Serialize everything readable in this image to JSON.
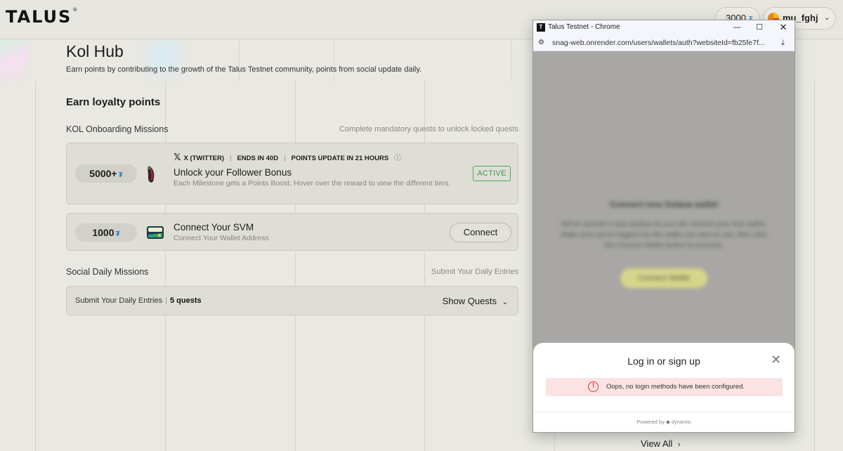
{
  "brand": {
    "logo_text": "TALUS",
    "logo_mark": "®"
  },
  "header": {
    "points": "3000",
    "points_symbol": "₮",
    "username": "mu_fghj",
    "dropdown_icon": "chevron-down-icon"
  },
  "page": {
    "title": "Kol Hub",
    "subtitle": "Earn points by contributing to the growth of the Talus Testnet community, points from social update daily.",
    "section_title": "Earn loyalty points"
  },
  "kol_missions": {
    "label": "KOL Onboarding Missions",
    "note": "Complete mandatory quests to unlock locked quests",
    "quests": [
      {
        "reward": "5000+",
        "reward_symbol": "₮",
        "platform": "X (TWITTER)",
        "ends": "ENDS IN 40D",
        "update": "POINTS UPDATE IN 21 HOURS",
        "title": "Unlock your Follower Bonus",
        "description": "Each Milestone gets a Points Boost. Hover over the reward to view the different tiers.",
        "status": "ACTIVE"
      },
      {
        "reward": "1000",
        "reward_symbol": "₮",
        "title": "Connect Your SVM",
        "description": "Connect Your Wallet Address",
        "action": "Connect"
      }
    ]
  },
  "daily_missions": {
    "label": "Social Daily Missions",
    "note": "Submit Your Daily Entries",
    "row_label": "Submit Your Daily Entries",
    "quest_count": "5 quests",
    "toggle_label": "Show Quests"
  },
  "view_all": "View All",
  "popup": {
    "window_title": "Talus Testnet - Chrome",
    "url": "snag-web.onrender.com/users/wallets/auth?websiteId=fb25fe7f...",
    "blurred_heading": "Connect new Solana wallet",
    "blurred_text": "We've opened a new window so you can connect your new wallet. Make sure you're logged into the wallet you want to use, then click the Connect Wallet button to proceed.",
    "blurred_button": "Connect Wallet",
    "login_title": "Log in or sign up",
    "error_text": "Oops, no login methods have been configured.",
    "powered_by": "Powered by",
    "powered_brand": "dynamic"
  }
}
